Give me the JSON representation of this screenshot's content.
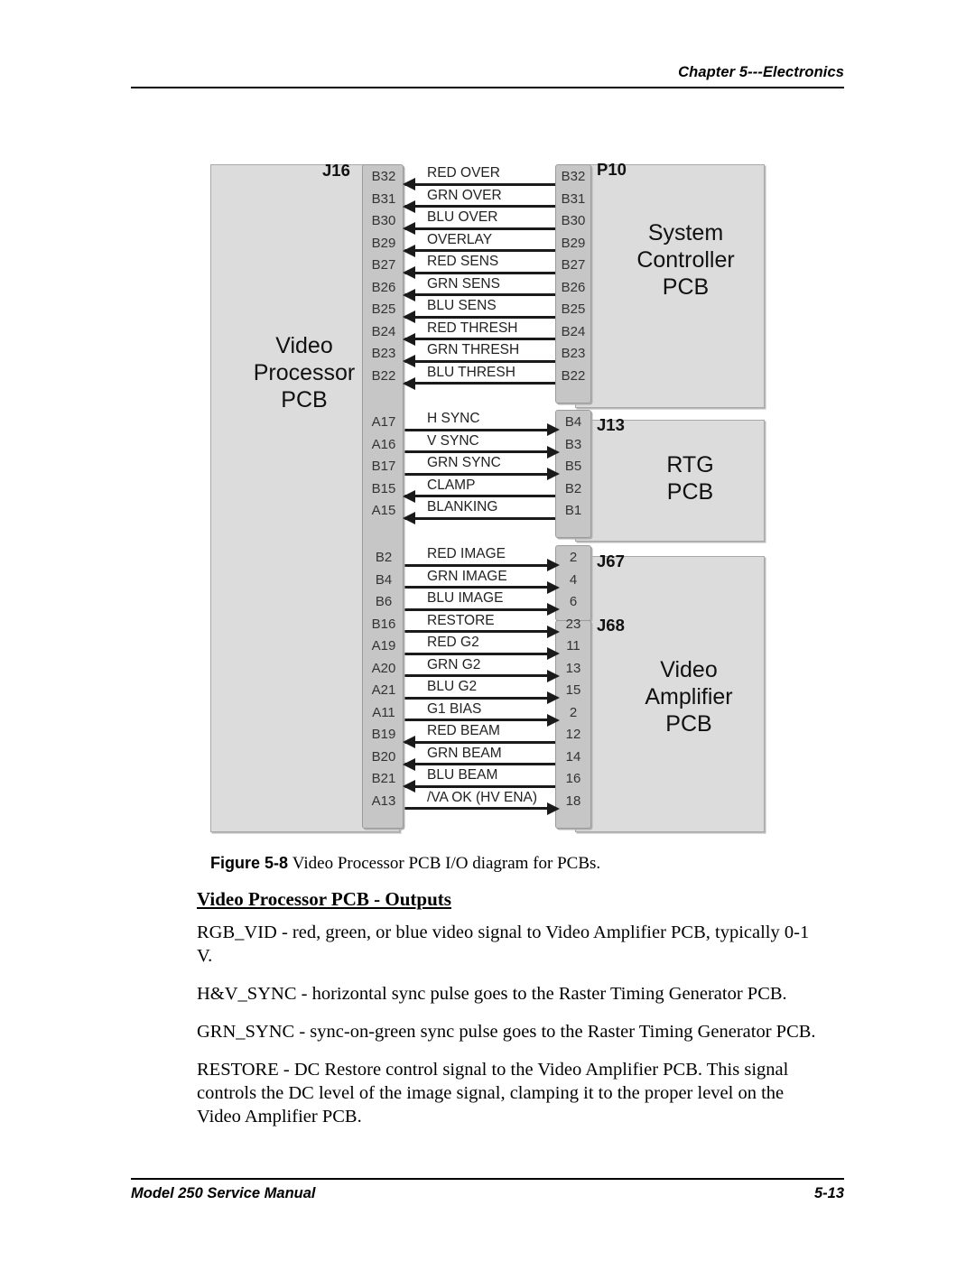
{
  "header": {
    "chapter": "Chapter 5---Electronics"
  },
  "footer": {
    "manual": "Model 250 Service Manual",
    "page": "5-13"
  },
  "figure": {
    "number": "Figure 5-8",
    "caption": "Video Processor PCB I/O diagram for PCBs.",
    "blocks": {
      "left": {
        "title": "Video\nProcessor\nPCB",
        "connector": "J16"
      },
      "system_controller": {
        "title": "System\nController\nPCB",
        "connector": "P10"
      },
      "rtg": {
        "title": "RTG\nPCB",
        "connector": "J13"
      },
      "video_amplifier": {
        "title": "Video\nAmplifier\nPCB",
        "connector_a": "J67",
        "connector_b": "J68"
      }
    },
    "groups": [
      {
        "id": "system-controller-group",
        "signals": [
          {
            "left_pin": "B32",
            "name": "RED OVER",
            "right_pin": "B32",
            "direction": "left"
          },
          {
            "left_pin": "B31",
            "name": "GRN OVER",
            "right_pin": "B31",
            "direction": "left"
          },
          {
            "left_pin": "B30",
            "name": "BLU OVER",
            "right_pin": "B30",
            "direction": "left"
          },
          {
            "left_pin": "B29",
            "name": "OVERLAY",
            "right_pin": "B29",
            "direction": "left"
          },
          {
            "left_pin": "B27",
            "name": "RED SENS",
            "right_pin": "B27",
            "direction": "left"
          },
          {
            "left_pin": "B26",
            "name": "GRN SENS",
            "right_pin": "B26",
            "direction": "left"
          },
          {
            "left_pin": "B25",
            "name": "BLU SENS",
            "right_pin": "B25",
            "direction": "left"
          },
          {
            "left_pin": "B24",
            "name": "RED THRESH",
            "right_pin": "B24",
            "direction": "left"
          },
          {
            "left_pin": "B23",
            "name": "GRN THRESH",
            "right_pin": "B23",
            "direction": "left"
          },
          {
            "left_pin": "B22",
            "name": "BLU THRESH",
            "right_pin": "B22",
            "direction": "left"
          }
        ]
      },
      {
        "id": "rtg-group",
        "signals": [
          {
            "left_pin": "A17",
            "name": "H SYNC",
            "right_pin": "B4",
            "direction": "right"
          },
          {
            "left_pin": "A16",
            "name": "V SYNC",
            "right_pin": "B3",
            "direction": "right"
          },
          {
            "left_pin": "B17",
            "name": "GRN SYNC",
            "right_pin": "B5",
            "direction": "right"
          },
          {
            "left_pin": "B15",
            "name": "CLAMP",
            "right_pin": "B2",
            "direction": "left"
          },
          {
            "left_pin": "A15",
            "name": "BLANKING",
            "right_pin": "B1",
            "direction": "left"
          }
        ]
      },
      {
        "id": "video-amplifier-group",
        "signals": [
          {
            "left_pin": "B2",
            "name": "RED IMAGE",
            "right_pin": "2",
            "direction": "right"
          },
          {
            "left_pin": "B4",
            "name": "GRN IMAGE",
            "right_pin": "4",
            "direction": "right"
          },
          {
            "left_pin": "B6",
            "name": "BLU IMAGE",
            "right_pin": "6",
            "direction": "right"
          },
          {
            "left_pin": "B16",
            "name": "RESTORE",
            "right_pin": "23",
            "direction": "right"
          },
          {
            "left_pin": "A19",
            "name": "RED G2",
            "right_pin": "11",
            "direction": "right"
          },
          {
            "left_pin": "A20",
            "name": "GRN G2",
            "right_pin": "13",
            "direction": "right"
          },
          {
            "left_pin": "A21",
            "name": "BLU G2",
            "right_pin": "15",
            "direction": "right"
          },
          {
            "left_pin": "A11",
            "name": "G1 BIAS",
            "right_pin": "2",
            "direction": "right"
          },
          {
            "left_pin": "B19",
            "name": "RED BEAM",
            "right_pin": "12",
            "direction": "left"
          },
          {
            "left_pin": "B20",
            "name": "GRN BEAM",
            "right_pin": "14",
            "direction": "left"
          },
          {
            "left_pin": "B21",
            "name": "BLU BEAM",
            "right_pin": "16",
            "direction": "left"
          },
          {
            "left_pin": "A13",
            "name": "/VA OK (HV ENA)",
            "right_pin": "18",
            "direction": "right"
          }
        ]
      }
    ]
  },
  "section": {
    "heading": "Video Processor PCB  - Outputs",
    "paragraphs": [
      "RGB_VID - red, green, or blue video signal to Video Amplifier PCB, typically 0-1 V.",
      "H&V_SYNC - horizontal sync pulse goes to the Raster Timing Generator PCB.",
      "GRN_SYNC - sync-on-green sync pulse goes to the Raster Timing Generator PCB.",
      "RESTORE - DC Restore control signal to the Video Amplifier PCB. This signal controls the DC level of the image signal, clamping it to the proper level on the Video Amplifier PCB."
    ]
  }
}
